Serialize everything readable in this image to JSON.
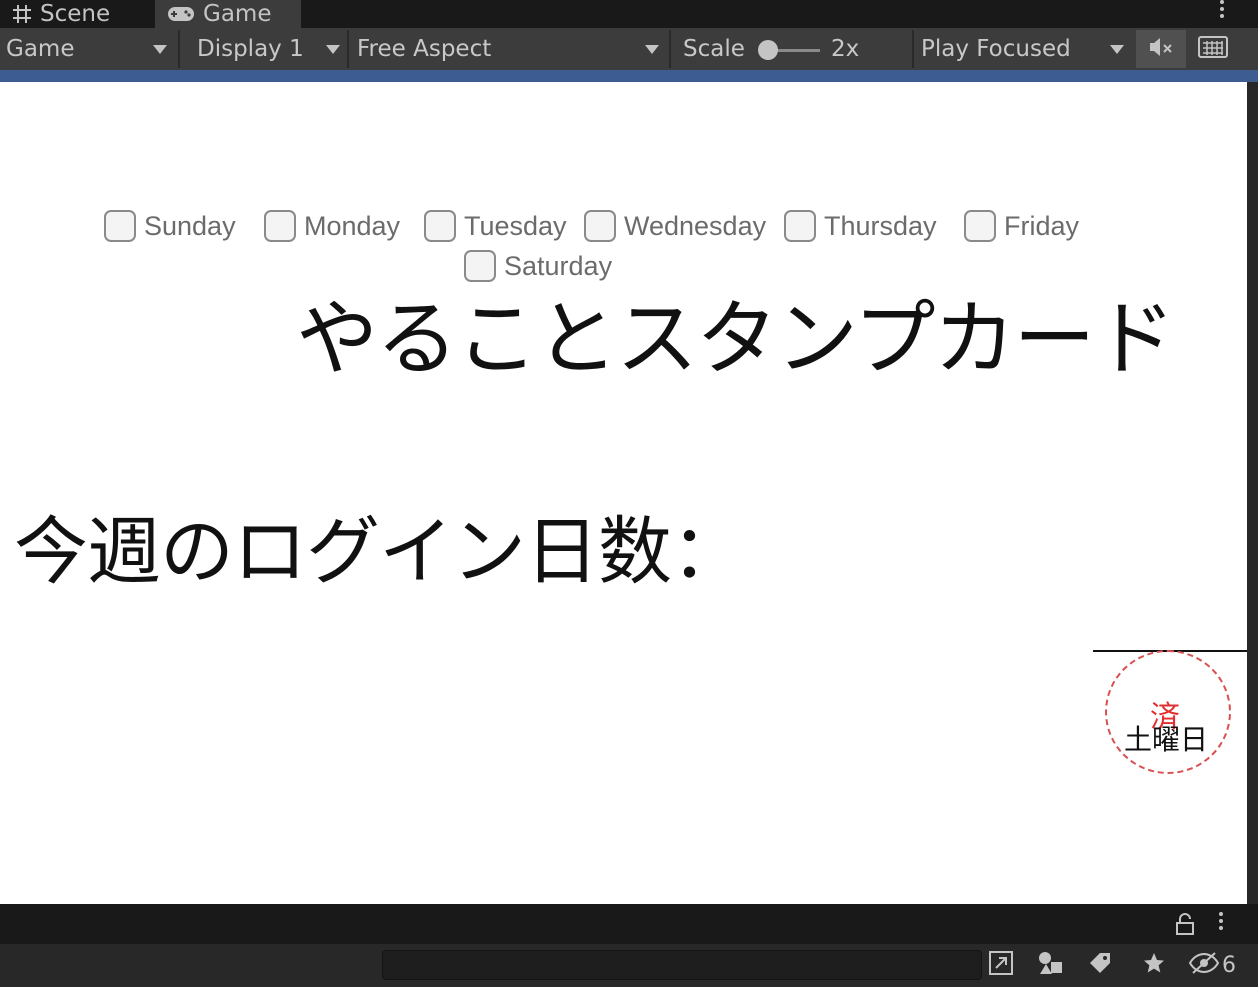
{
  "tabs": [
    {
      "label": "Scene",
      "icon": "grid-icon"
    },
    {
      "label": "Game",
      "icon": "gamepad-icon",
      "active": true
    }
  ],
  "toolbar": {
    "display_mode": "Game",
    "display": "Display 1",
    "aspect": "Free Aspect",
    "scale_label": "Scale",
    "scale_value": "2x",
    "play_mode": "Play Focused"
  },
  "game": {
    "days": [
      "Sunday",
      "Monday",
      "Tuesday",
      "Wednesday",
      "Thursday",
      "Friday",
      "Saturday"
    ],
    "title": "やることスタンプカード",
    "login_label": "今週のログイン日数：",
    "stamp_mark": "済",
    "stamp_day": "土曜日"
  },
  "project": {
    "search_value": "",
    "hidden_count": "6"
  },
  "colors": {
    "accent_strip": "#3d5d92",
    "stamp": "#e03030"
  }
}
